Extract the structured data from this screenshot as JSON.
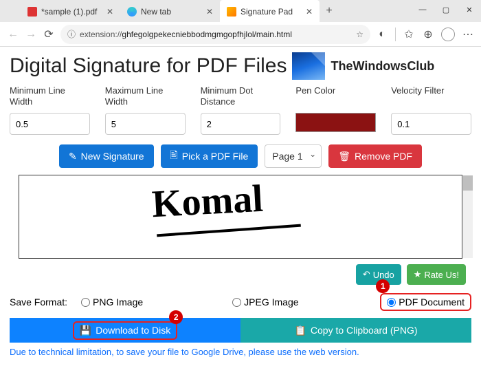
{
  "browser": {
    "tabs": [
      {
        "title": "*sample (1).pdf",
        "icon": "pdf"
      },
      {
        "title": "New tab",
        "icon": "edge"
      },
      {
        "title": "Signature Pad",
        "icon": "pen",
        "active": true
      }
    ],
    "url_prefix": "extension://",
    "url_rest": "ghfegolgpekecniebbodmgmgopfhjlol/main.html"
  },
  "page": {
    "title": "Digital Signature for PDF Files",
    "brand": "TheWindowsClub",
    "controls": {
      "min_line": {
        "label": "Minimum Line Width",
        "value": "0.5"
      },
      "max_line": {
        "label": "Maximum Line Width",
        "value": "5"
      },
      "min_dot": {
        "label": "Minimum Dot Distance",
        "value": "2"
      },
      "pen_color": {
        "label": "Pen Color",
        "value": "#8b1212"
      },
      "velocity": {
        "label": "Velocity Filter",
        "value": "0.1"
      }
    },
    "buttons": {
      "new_sig": "New Signature",
      "pick_pdf": "Pick a PDF File",
      "page_sel": "Page 1",
      "remove_pdf": "Remove PDF",
      "undo": "Undo",
      "rate": "Rate Us!",
      "download": "Download to Disk",
      "copy": "Copy to Clipboard (PNG)"
    },
    "signature_text": "Komal",
    "save_format": {
      "label": "Save Format:",
      "png": "PNG Image",
      "jpeg": "JPEG Image",
      "pdf": "PDF Document",
      "selected": "pdf"
    },
    "note": "Due to technical limitation, to save your file to Google Drive, please use the web version."
  },
  "callouts": {
    "pdf": "1",
    "download": "2"
  }
}
